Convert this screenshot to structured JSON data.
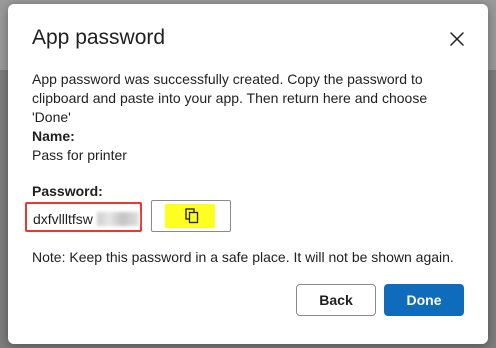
{
  "dialog": {
    "title": "App password",
    "message": "App password was successfully created. Copy the password to clipboard and paste into your app. Then return here and choose 'Done'",
    "name_label": "Name:",
    "name_value": "Pass for printer",
    "password_label": "Password:",
    "password_visible": "dxfvllltfsw",
    "note": "Note: Keep this password in a safe place. It will not be shown again.",
    "back_label": "Back",
    "done_label": "Done"
  },
  "icons": {
    "close": "close-icon",
    "copy": "copy-icon"
  },
  "colors": {
    "primary": "#0f6cbd",
    "highlight": "#ffff22",
    "error_outline": "#e53935"
  }
}
